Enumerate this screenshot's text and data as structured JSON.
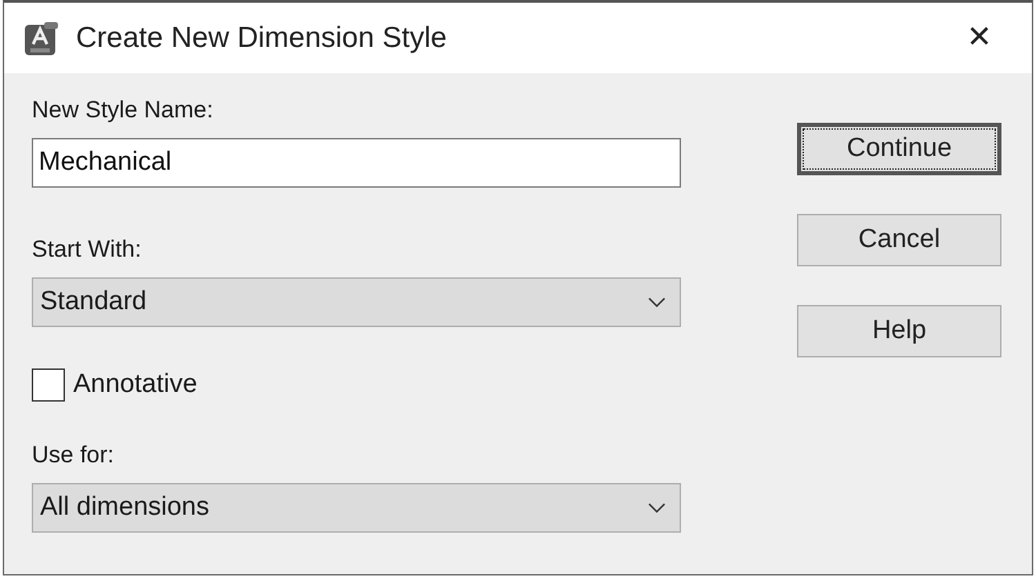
{
  "window": {
    "title": "Create New Dimension Style",
    "close": "✕"
  },
  "fields": [
    {
      "kind": "text",
      "label": "New Style Name:",
      "value": "Mechanical"
    },
    {
      "kind": "combo",
      "label": "Start With:",
      "value": "Standard"
    },
    {
      "kind": "checkbox",
      "label": "Annotative",
      "checked": false
    },
    {
      "kind": "combo",
      "label": "Use for:",
      "value": "All dimensions"
    }
  ],
  "buttons": [
    {
      "label": "Continue",
      "default": true
    },
    {
      "label": "Cancel",
      "default": false
    },
    {
      "label": "Help",
      "default": false
    }
  ]
}
